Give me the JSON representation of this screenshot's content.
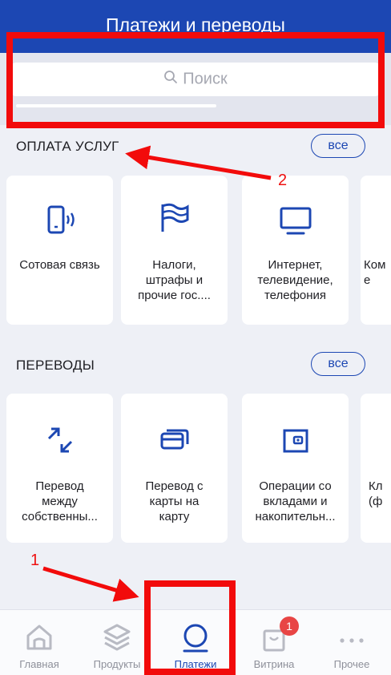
{
  "header": {
    "title": "Платежи и переводы"
  },
  "search": {
    "placeholder": "Поиск"
  },
  "services": {
    "title": "ОПЛАТА УСЛУГ",
    "all_label": "все",
    "items": [
      {
        "label": "Сотовая связь",
        "icon": "mobile-phone-icon"
      },
      {
        "label": "Налоги,\nштрафы и\nпрочие гос....",
        "icon": "flag-icon"
      },
      {
        "label": "Интернет,\nтелевидение,\nтелефония",
        "icon": "tv-icon"
      },
      {
        "label": "Ком\nе",
        "icon": ""
      }
    ]
  },
  "transfers": {
    "title": "ПЕРЕВОДЫ",
    "all_label": "все",
    "items": [
      {
        "label": "Перевод\nмежду\nсобственны...",
        "icon": "transfer-arrows-icon"
      },
      {
        "label": "Перевод с\nкарты на\nкарту",
        "icon": "cards-icon"
      },
      {
        "label": "Операции со\nвкладами и\nнакопительн...",
        "icon": "wallet-icon"
      },
      {
        "label": "Кл\n(ф",
        "icon": ""
      }
    ]
  },
  "nav": {
    "items": [
      {
        "label": "Главная",
        "icon": "home-icon"
      },
      {
        "label": "Продукты",
        "icon": "layers-icon"
      },
      {
        "label": "Платежи",
        "icon": "payments-icon",
        "active": true
      },
      {
        "label": "Витрина",
        "icon": "shopping-bag-icon",
        "badge": "1"
      },
      {
        "label": "Прочее",
        "icon": "more-icon"
      }
    ]
  },
  "annotations": {
    "label_1": "1",
    "label_2": "2",
    "color": "#f20b0b"
  },
  "colors": {
    "brand": "#1c47b3",
    "background": "#eef0f6",
    "badge": "#e84545"
  }
}
